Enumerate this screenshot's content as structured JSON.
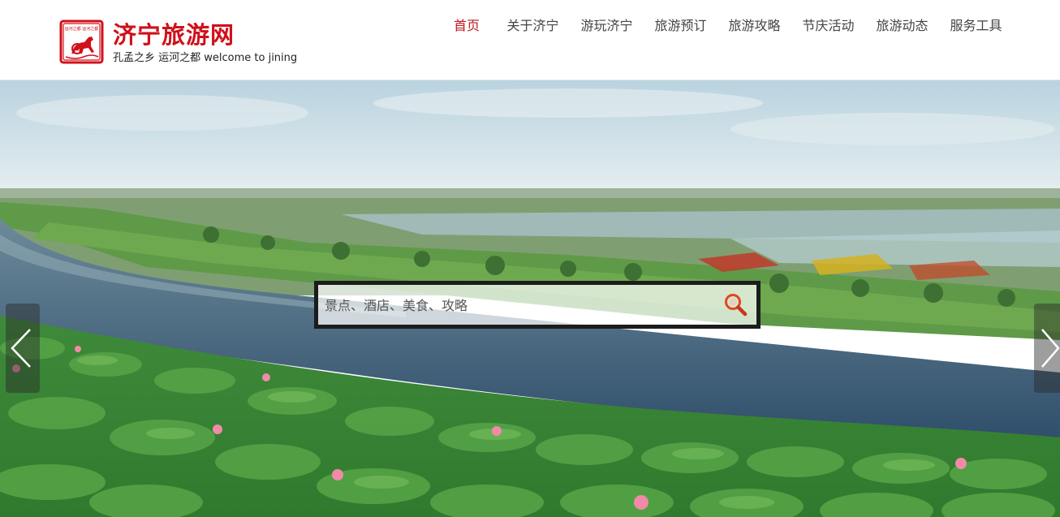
{
  "header": {
    "title": "济宁旅游网",
    "slogan": "孔孟之乡 运河之都 welcome to jining",
    "seal_text": "运河之都 运河之都"
  },
  "nav": {
    "items": [
      {
        "label": "首页",
        "active": true
      },
      {
        "label": "关于济宁",
        "active": false
      },
      {
        "label": "游玩济宁",
        "active": false
      },
      {
        "label": "旅游预订",
        "active": false
      },
      {
        "label": "旅游攻略",
        "active": false
      },
      {
        "label": "节庆活动",
        "active": false
      },
      {
        "label": "旅游动态",
        "active": false
      },
      {
        "label": "服务工具",
        "active": false
      }
    ]
  },
  "search": {
    "placeholder": "景点、酒店、美食、攻略",
    "value": ""
  },
  "banner": {
    "prev_icon": "chevron-left-icon",
    "next_icon": "chevron-right-icon",
    "search_icon": "search-icon"
  },
  "colors": {
    "brand_red": "#d0101a",
    "nav_active": "#c0171f",
    "nav_text": "#444444",
    "search_border": "#1c1c1c"
  }
}
